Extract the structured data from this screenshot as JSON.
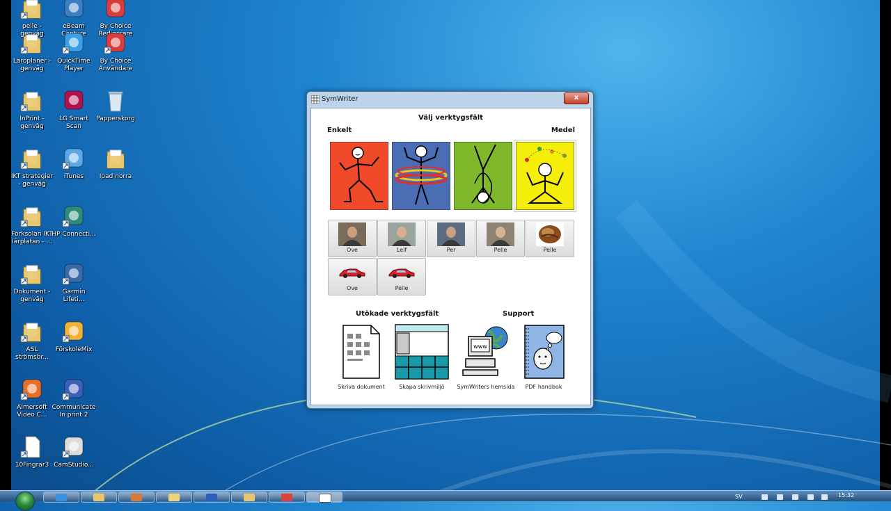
{
  "desktop": {
    "icons": [
      {
        "label": "pelle - genväg",
        "icon": "folder-shortcut-icon"
      },
      {
        "label": "eBeam Capture",
        "icon": "ebeam-icon"
      },
      {
        "label": "By Choice Redigerare",
        "icon": "bychoice-editor-icon"
      },
      {
        "label": "Läroplaner - genväg",
        "icon": "folder-shortcut-icon"
      },
      {
        "label": "QuickTime Player",
        "icon": "quicktime-icon"
      },
      {
        "label": "By Choice Användare",
        "icon": "bychoice-user-icon"
      },
      {
        "label": "InPrint - genväg",
        "icon": "folder-shortcut-icon"
      },
      {
        "label": "LG Smart Scan",
        "icon": "lg-smartscan-icon"
      },
      {
        "label": "Papperskorg",
        "icon": "recycle-bin-icon"
      },
      {
        "label": "IKT strategier - genväg",
        "icon": "folder-shortcut-icon"
      },
      {
        "label": "iTunes",
        "icon": "itunes-icon"
      },
      {
        "label": "Ipad norra",
        "icon": "folder-icon"
      },
      {
        "label": "Förksolan IKT lärplatan - ...",
        "icon": "folder-shortcut-icon"
      },
      {
        "label": "HP Connecti...",
        "icon": "hp-connect-icon"
      },
      {
        "label": "Dokument - genväg",
        "icon": "folder-shortcut-icon"
      },
      {
        "label": "Garmin Lifeti...",
        "icon": "garmin-icon"
      },
      {
        "label": "ASL strömsbr...",
        "icon": "folder-shortcut-icon"
      },
      {
        "label": "FörskoleMix",
        "icon": "forskolemix-icon"
      },
      {
        "label": "Aimersoft Video C...",
        "icon": "aimersoft-icon"
      },
      {
        "label": "Communicate In print 2",
        "icon": "communicate-icon"
      },
      {
        "label": "10Fingrar3",
        "icon": "file-icon"
      },
      {
        "label": "CamStudio...",
        "icon": "camstudio-icon"
      }
    ]
  },
  "window": {
    "title": "SymWriter",
    "close_label": "x",
    "heading": "Välj verktygsfält",
    "left_label": "Enkelt",
    "right_label": "Medel",
    "level_tiles": [
      {
        "name": "dancing-figure",
        "color": "#f04a2a"
      },
      {
        "name": "hula-hoop-figure",
        "color": "#4a6db3"
      },
      {
        "name": "handstand-figure",
        "color": "#7fb82a"
      },
      {
        "name": "juggling-figure",
        "color": "#f5ee0a"
      }
    ],
    "users": [
      {
        "name": "Ove",
        "pic": "photo"
      },
      {
        "name": "Leif",
        "pic": "photo"
      },
      {
        "name": "Per",
        "pic": "photo"
      },
      {
        "name": "Pelle",
        "pic": "photo"
      },
      {
        "name": "Pelle",
        "pic": "stone"
      },
      {
        "name": "Ove",
        "pic": "car"
      },
      {
        "name": "Pelle",
        "pic": "car"
      }
    ],
    "extended_heading": "Utökade verktygsfält",
    "support_heading": "Support",
    "links": [
      {
        "label": "Skriva dokument",
        "icon": "document-icon"
      },
      {
        "label": "Skapa skrivmiljö",
        "icon": "grid-environment-icon"
      },
      {
        "label": "SymWriters hemsida",
        "icon": "www-computer-icon"
      },
      {
        "label": "PDF handbok",
        "icon": "handbook-icon"
      }
    ]
  },
  "taskbar": {
    "language": "SV",
    "time": "15:32"
  }
}
